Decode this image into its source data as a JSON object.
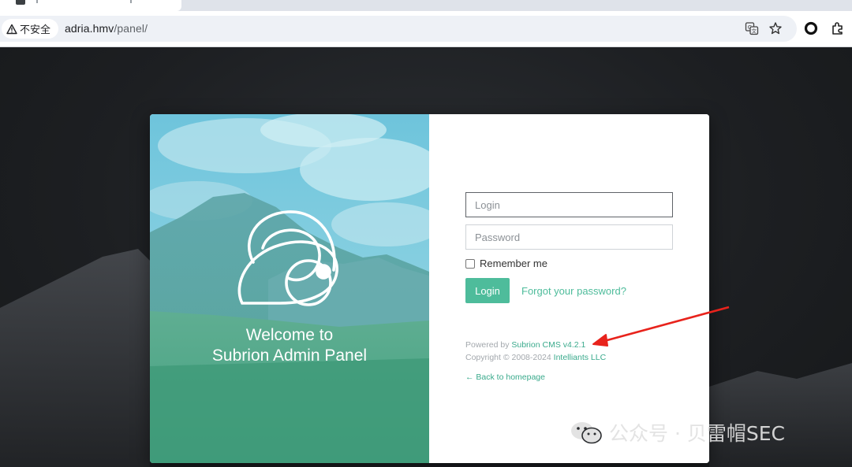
{
  "browser": {
    "security_label": "不安全",
    "url_host": "adria.hmv",
    "url_path": "/panel/",
    "icons": [
      "warning-icon",
      "translate-icon",
      "bookmark-star-icon",
      "record-icon",
      "extensions-icon"
    ]
  },
  "panel": {
    "welcome_line1": "Welcome to",
    "welcome_line2": "Subrion Admin Panel",
    "login_placeholder": "Login",
    "password_placeholder": "Password",
    "remember_label": "Remember me",
    "login_button": "Login",
    "forgot_link": "Forgot your password?",
    "powered_by_prefix": "Powered by",
    "powered_by_link": "Subrion CMS v4.2.1",
    "copyright_prefix": "Copyright © 2008-2024",
    "copyright_link": "Intelliants LLC",
    "back_link": "← Back to homepage"
  },
  "watermark": {
    "text": "公众号 · 贝雷帽SEC"
  },
  "colors": {
    "accent": "#4ebc9b",
    "annotation_arrow": "#e8231c"
  }
}
